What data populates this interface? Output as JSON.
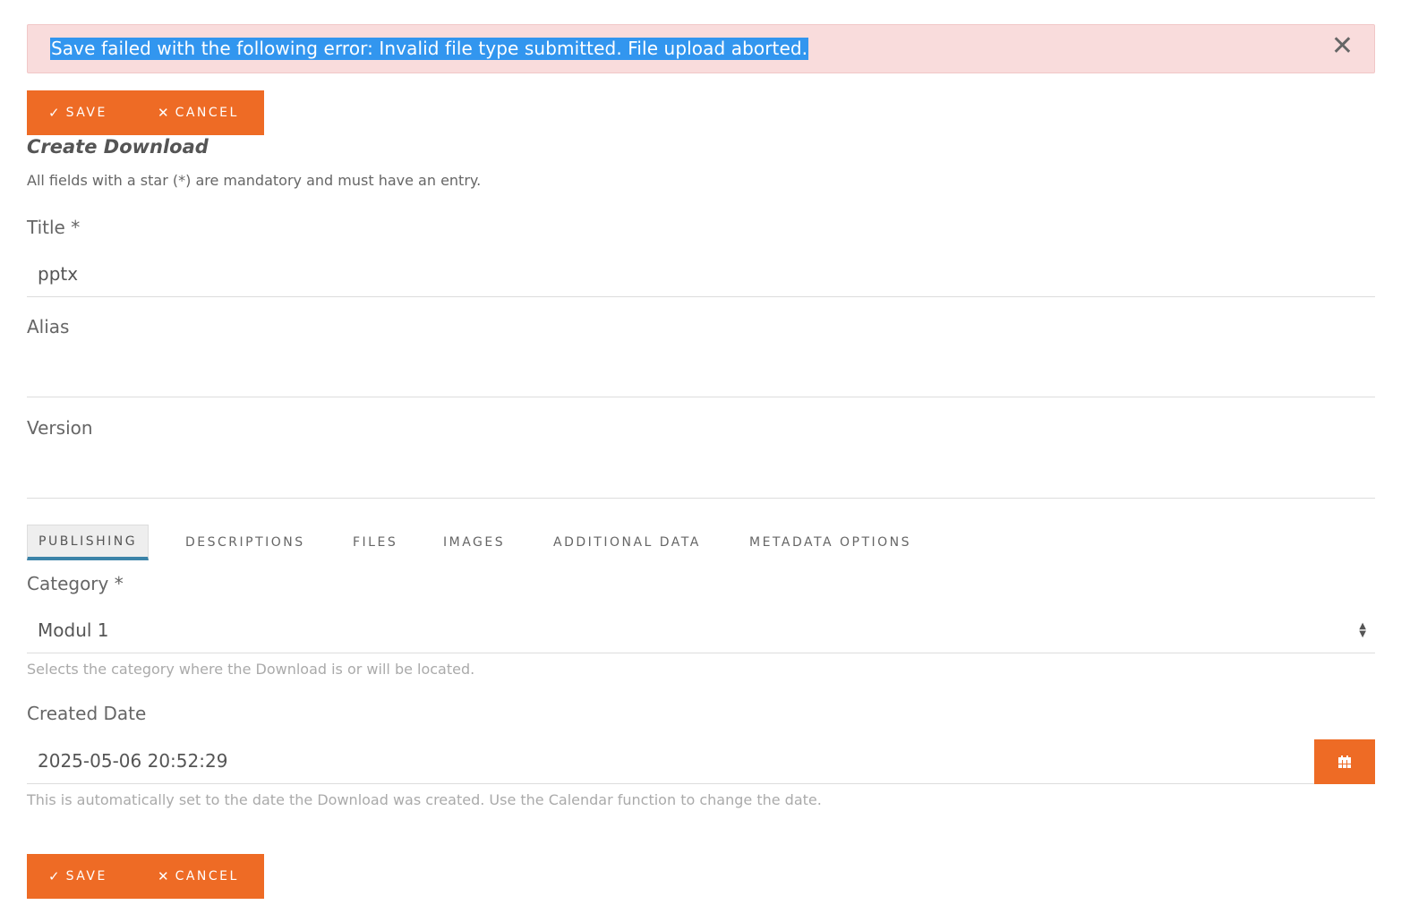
{
  "alert": {
    "message": "Save failed with the following error: Invalid file type submitted. File upload aborted.",
    "close_glyph": "✕"
  },
  "toolbar": {
    "save_label": "SAVE",
    "cancel_label": "CANCEL",
    "save_glyph": "✓",
    "cancel_glyph": "✕"
  },
  "form": {
    "title": "Create Download",
    "note": "All fields with a star (*) are mandatory and must have an entry."
  },
  "fields": {
    "title": {
      "label": "Title *",
      "value": "pptx"
    },
    "alias": {
      "label": "Alias",
      "value": ""
    },
    "version": {
      "label": "Version",
      "value": ""
    }
  },
  "tabs": [
    {
      "label": "PUBLISHING",
      "active": true
    },
    {
      "label": "DESCRIPTIONS",
      "active": false
    },
    {
      "label": "FILES",
      "active": false
    },
    {
      "label": "IMAGES",
      "active": false
    },
    {
      "label": "ADDITIONAL DATA",
      "active": false
    },
    {
      "label": "METADATA OPTIONS",
      "active": false
    }
  ],
  "publishing": {
    "category": {
      "label": "Category *",
      "selected": "Modul 1",
      "hint": "Selects the category where the Download is or will be located."
    },
    "created_date": {
      "label": "Created Date",
      "value": "2025-05-06 20:52:29",
      "hint": "This is automatically set to the date the Download was created. Use the Calendar function to change the date."
    }
  },
  "colors": {
    "accent": "#ee6b25",
    "alert_bg": "#f9dcdc",
    "tab_underline": "#3b83a8",
    "selection": "#3296ef"
  },
  "icons": {
    "close": "close-icon",
    "check": "check-icon",
    "cancel": "x-icon",
    "select_arrows": "sort-arrows-icon",
    "calendar": "calendar-icon"
  }
}
